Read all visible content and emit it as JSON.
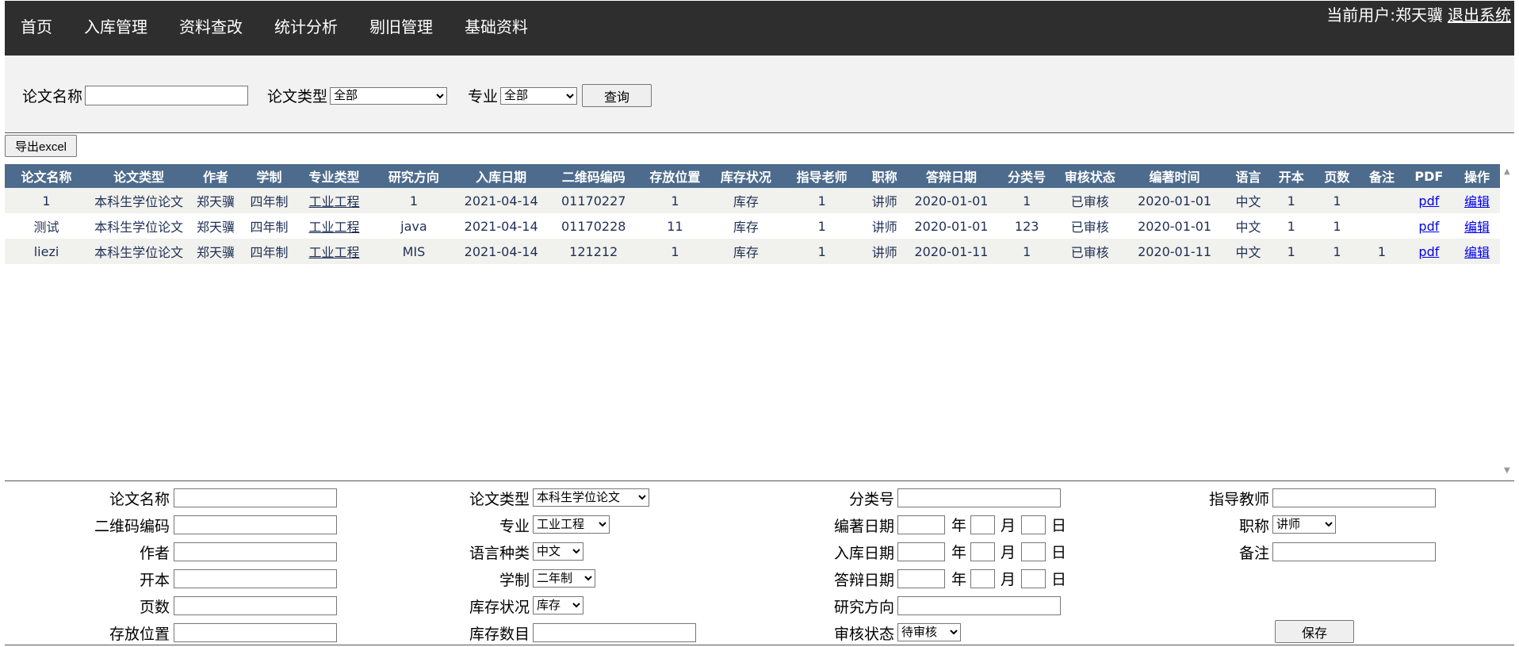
{
  "nav": {
    "items": [
      "首页",
      "入库管理",
      "资料查改",
      "统计分析",
      "剔旧管理",
      "基础资料"
    ],
    "current_user": "当前用户:郑天骥",
    "logout": "退出系统"
  },
  "search": {
    "name_label": "论文名称",
    "name_value": "",
    "type_label": "论文类型",
    "type_selected": "全部",
    "major_label": "专业",
    "major_selected": "全部",
    "query_button": "查询"
  },
  "export_button": "导出excel",
  "table": {
    "headers": [
      "论文名称",
      "论文类型",
      "作者",
      "学制",
      "专业类型",
      "研究方向",
      "入库日期",
      "二维码编码",
      "存放位置",
      "库存状况",
      "指导老师",
      "职称",
      "答辩日期",
      "分类号",
      "审核状态",
      "编著时间",
      "语言",
      "开本",
      "页数",
      "备注",
      "PDF",
      "操作"
    ],
    "rows": [
      [
        "1",
        "本科生学位论文",
        "郑天骥",
        "四年制",
        "工业工程",
        "1",
        "2021-04-14",
        "01170227",
        "1",
        "库存",
        "1",
        "讲师",
        "2020-01-01",
        "1",
        "已审核",
        "2020-01-01",
        "中文",
        "1",
        "1",
        "",
        "pdf",
        "编辑"
      ],
      [
        "测试",
        "本科生学位论文",
        "郑天骥",
        "四年制",
        "工业工程",
        "java",
        "2021-04-14",
        "01170228",
        "11",
        "库存",
        "1",
        "讲师",
        "2020-01-01",
        "123",
        "已审核",
        "2020-01-01",
        "中文",
        "1",
        "1",
        "",
        "pdf",
        "编辑"
      ],
      [
        "liezi",
        "本科生学位论文",
        "郑天骥",
        "四年制",
        "工业工程",
        "MIS",
        "2021-04-14",
        "121212",
        "1",
        "库存",
        "1",
        "讲师",
        "2020-01-11",
        "1",
        "已审核",
        "2020-01-11",
        "中文",
        "1",
        "1",
        "1",
        "pdf",
        "编辑"
      ]
    ]
  },
  "form": {
    "name_label": "论文名称",
    "qrcode_label": "二维码编码",
    "author_label": "作者",
    "format_label": "开本",
    "pages_label": "页数",
    "location_label": "存放位置",
    "type_label": "论文类型",
    "type_selected": "本科生学位论文",
    "major_label": "专业",
    "major_selected": "工业工程",
    "language_label": "语言种类",
    "language_selected": "中文",
    "schooling_label": "学制",
    "schooling_selected": "二年制",
    "stock_label": "库存状况",
    "stock_selected": "库存",
    "stock_count_label": "库存数目",
    "class_label": "分类号",
    "compile_date_label": "编著日期",
    "entry_date_label": "入库日期",
    "defense_date_label": "答辩日期",
    "research_label": "研究方向",
    "review_label": "审核状态",
    "review_selected": "待审核",
    "year": "年",
    "month": "月",
    "day": "日",
    "advisor_label": "指导教师",
    "title_label": "职称",
    "title_selected": "讲师",
    "remark_label": "备注",
    "save_button": "保存"
  }
}
